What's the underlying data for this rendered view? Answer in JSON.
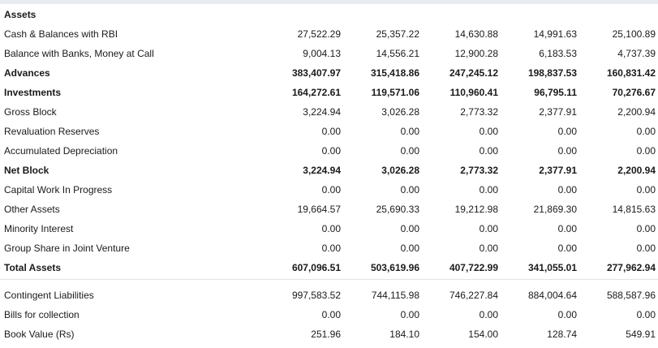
{
  "section_title": "Assets",
  "rows": [
    {
      "label": "Cash & Balances with RBI",
      "bold": false,
      "values": [
        "27,522.29",
        "25,357.22",
        "14,630.88",
        "14,991.63",
        "25,100.89"
      ]
    },
    {
      "label": "Balance with Banks, Money at Call",
      "bold": false,
      "values": [
        "9,004.13",
        "14,556.21",
        "12,900.28",
        "6,183.53",
        "4,737.39"
      ]
    },
    {
      "label": "Advances",
      "bold": true,
      "values": [
        "383,407.97",
        "315,418.86",
        "247,245.12",
        "198,837.53",
        "160,831.42"
      ]
    },
    {
      "label": "Investments",
      "bold": true,
      "values": [
        "164,272.61",
        "119,571.06",
        "110,960.41",
        "96,795.11",
        "70,276.67"
      ]
    },
    {
      "label": "Gross Block",
      "bold": false,
      "values": [
        "3,224.94",
        "3,026.28",
        "2,773.32",
        "2,377.91",
        "2,200.94"
      ]
    },
    {
      "label": "Revaluation Reserves",
      "bold": false,
      "values": [
        "0.00",
        "0.00",
        "0.00",
        "0.00",
        "0.00"
      ]
    },
    {
      "label": "Accumulated Depreciation",
      "bold": false,
      "values": [
        "0.00",
        "0.00",
        "0.00",
        "0.00",
        "0.00"
      ]
    },
    {
      "label": "Net Block",
      "bold": true,
      "values": [
        "3,224.94",
        "3,026.28",
        "2,773.32",
        "2,377.91",
        "2,200.94"
      ]
    },
    {
      "label": "Capital Work In Progress",
      "bold": false,
      "values": [
        "0.00",
        "0.00",
        "0.00",
        "0.00",
        "0.00"
      ]
    },
    {
      "label": "Other Assets",
      "bold": false,
      "values": [
        "19,664.57",
        "25,690.33",
        "19,212.98",
        "21,869.30",
        "14,815.63"
      ]
    },
    {
      "label": "Minority Interest",
      "bold": false,
      "values": [
        "0.00",
        "0.00",
        "0.00",
        "0.00",
        "0.00"
      ]
    },
    {
      "label": "Group Share in Joint Venture",
      "bold": false,
      "values": [
        "0.00",
        "0.00",
        "0.00",
        "0.00",
        "0.00"
      ]
    },
    {
      "label": "Total Assets",
      "bold": true,
      "values": [
        "607,096.51",
        "503,619.96",
        "407,722.99",
        "341,055.01",
        "277,962.94"
      ]
    }
  ],
  "extra_rows": [
    {
      "label": "Contingent Liabilities",
      "bold": false,
      "values": [
        "997,583.52",
        "744,115.98",
        "746,227.84",
        "884,004.64",
        "588,587.96"
      ]
    },
    {
      "label": "Bills for collection",
      "bold": false,
      "values": [
        "0.00",
        "0.00",
        "0.00",
        "0.00",
        "0.00"
      ]
    },
    {
      "label": "Book Value (Rs)",
      "bold": false,
      "values": [
        "251.96",
        "184.10",
        "154.00",
        "128.74",
        "549.91"
      ]
    }
  ]
}
